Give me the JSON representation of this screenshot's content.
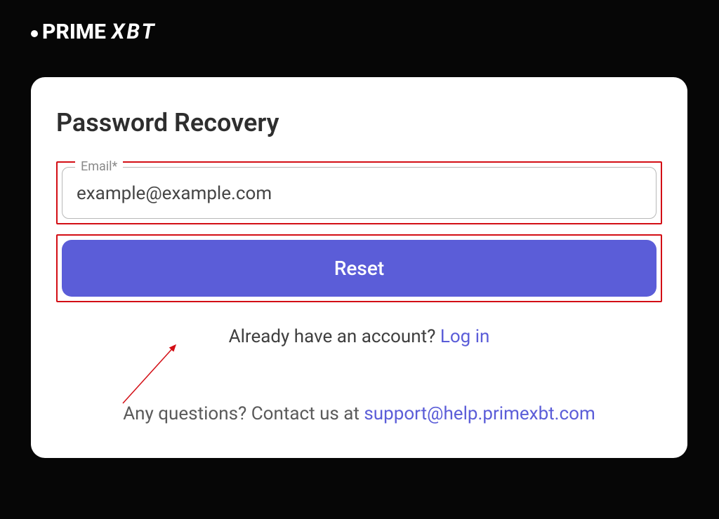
{
  "logo": {
    "prime": "PRIME",
    "xbt": "XBT"
  },
  "card": {
    "title": "Password Recovery",
    "email_label": "Email*",
    "email_value": "example@example.com",
    "reset_button": "Reset",
    "already_text": "Already have an account? ",
    "login_link": "Log in",
    "questions_text": "Any questions? Contact us at ",
    "support_email": "support@help.primexbt.com"
  }
}
